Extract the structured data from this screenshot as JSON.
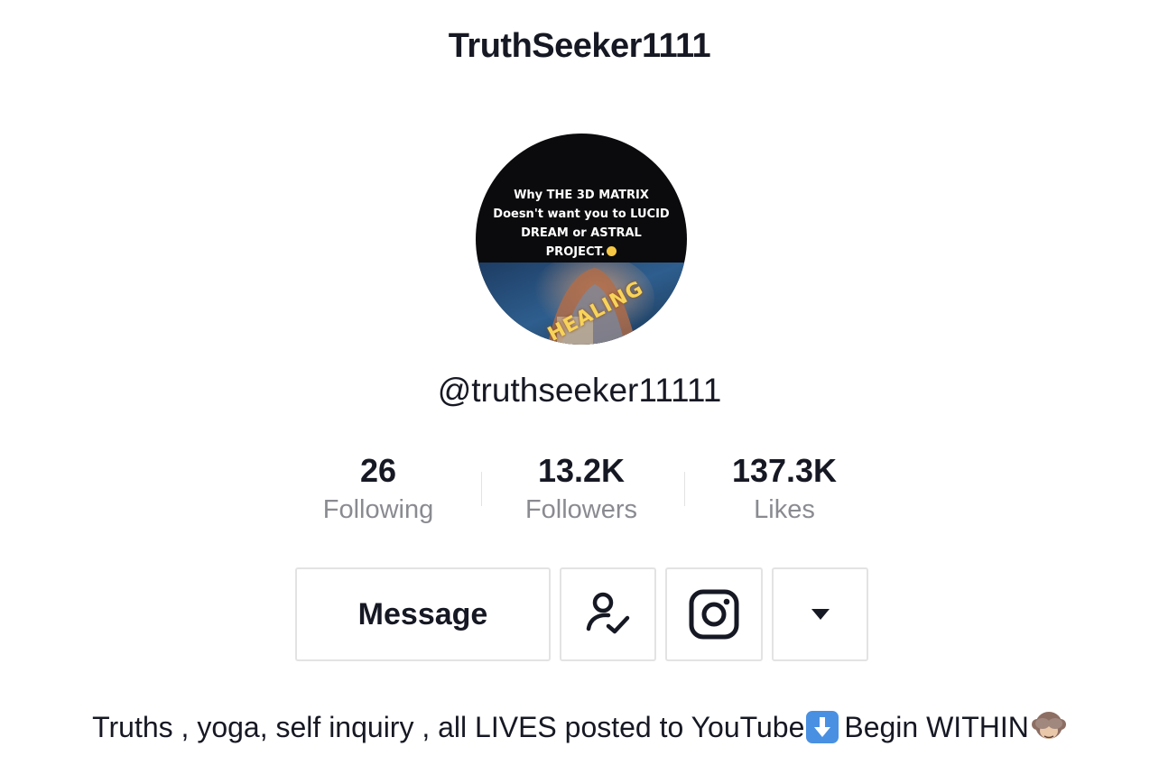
{
  "header": {
    "title": "TruthSeeker1111"
  },
  "avatar": {
    "caption": "Why THE 3D MATRIX\nDoesn't want you to LUCID\nDREAM or ASTRAL\nPROJECT.",
    "stamp_text": "HEALING"
  },
  "profile": {
    "handle": "@truthseeker11111"
  },
  "stats": [
    {
      "value": "26",
      "label": "Following"
    },
    {
      "value": "13.2K",
      "label": "Followers"
    },
    {
      "value": "137.3K",
      "label": "Likes"
    }
  ],
  "actions": {
    "message_label": "Message",
    "following_icon": "user-check-icon",
    "instagram_icon": "instagram-icon",
    "more_icon": "caret-down-icon"
  },
  "bio": {
    "text_before": "Truths , yoga, self inquiry , all LIVES posted to YouTube",
    "text_after": "Begin WITHIN",
    "arrow_icon": "down-arrow-emoji",
    "monkey_icon": "see-no-evil-monkey-emoji"
  },
  "colors": {
    "text": "#161823",
    "secondary_text": "#8a8b91",
    "border": "#e3e3e4",
    "arrow_emoji": "#4a90e2"
  }
}
